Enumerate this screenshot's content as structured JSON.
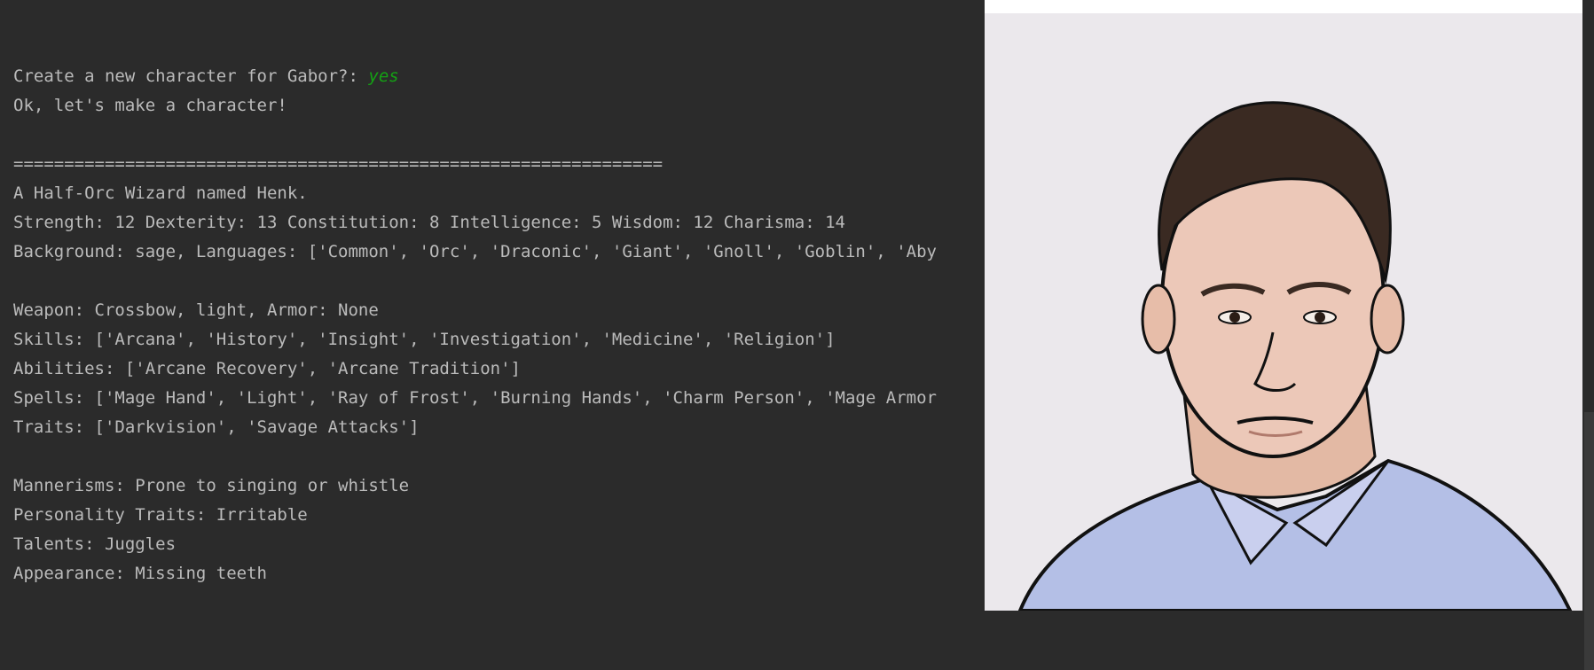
{
  "console": {
    "prompt": "Create a new character for Gabor?: ",
    "answer": "yes",
    "lines": [
      "Ok, let's make a character!",
      "",
      "================================================================",
      "A Half-Orc Wizard named Henk.",
      "Strength: 12 Dexterity: 13 Constitution: 8 Intelligence: 5 Wisdom: 12 Charisma: 14",
      "Background: sage, Languages: ['Common', 'Orc', 'Draconic', 'Giant', 'Gnoll', 'Goblin', 'Aby",
      "",
      "Weapon: Crossbow, light, Armor: None",
      "Skills: ['Arcana', 'History', 'Insight', 'Investigation', 'Medicine', 'Religion']",
      "Abilities: ['Arcane Recovery', 'Arcane Tradition']",
      "Spells: ['Mage Hand', 'Light', 'Ray of Frost', 'Burning Hands', 'Charm Person', 'Mage Armor",
      "Traits: ['Darkvision', 'Savage Attacks']",
      "",
      "Mannerisms: Prone to singing or whistle",
      "Personality Traits: Irritable",
      "Talents: Juggles",
      "Appearance: Missing teeth"
    ]
  },
  "image": {
    "subject": "character-portrait",
    "background": "#ebe8ec"
  }
}
